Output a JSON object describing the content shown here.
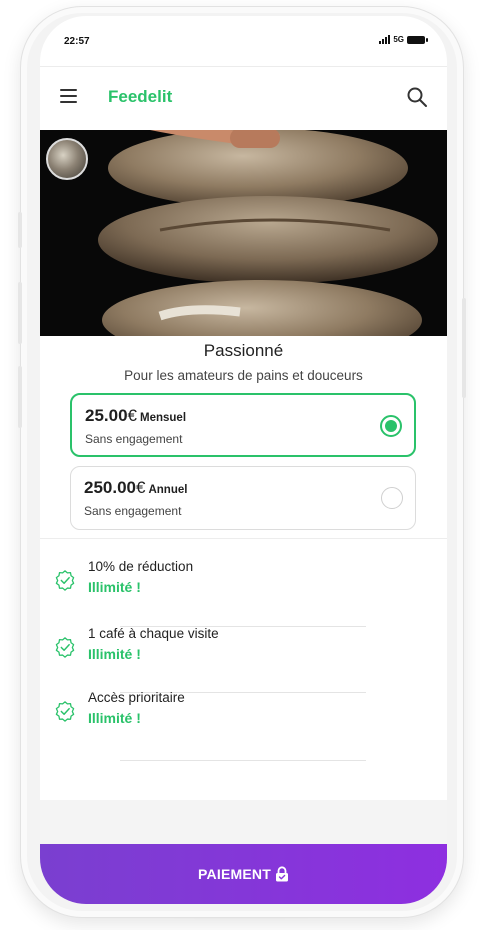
{
  "status": {
    "time": "22:57",
    "network": "5G"
  },
  "app": {
    "brand": "Feedelit"
  },
  "plan": {
    "title": "Passionné",
    "subtitle": "Pour les amateurs de pains et douceurs",
    "options": [
      {
        "price": "25.00",
        "currency": "€",
        "period": "Mensuel",
        "note": "Sans engagement",
        "selected": true
      },
      {
        "price": "250.00",
        "currency": "€",
        "period": "Annuel",
        "note": "Sans engagement",
        "selected": false
      }
    ],
    "perks": [
      {
        "name": "10% de réduction",
        "value": "Illimité !"
      },
      {
        "name": "1 café à chaque visite",
        "value": "Illimité !"
      },
      {
        "name": "Accès prioritaire",
        "value": "Illimité !"
      }
    ]
  },
  "payment": {
    "label": "PAIEMENT"
  },
  "colors": {
    "accent": "#2ac26a",
    "button_start": "#7a3fd0",
    "button_end": "#8e2fe0"
  },
  "icons": {
    "menu": "menu-icon",
    "search": "search-icon",
    "check": "check-badge-icon",
    "lock": "lock-icon"
  }
}
